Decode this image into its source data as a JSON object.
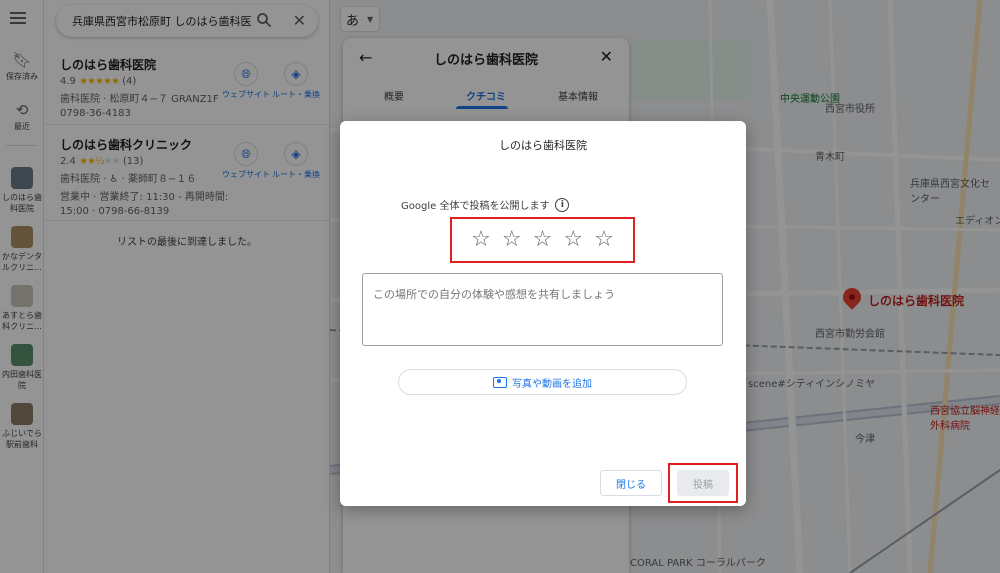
{
  "search": {
    "query": "兵庫県西宮市松原町 しのはら歯科医",
    "ime_char": "あ"
  },
  "rail": {
    "saved": "保存済み",
    "recent": "最近",
    "items": [
      {
        "label": "しのはら歯科医院"
      },
      {
        "label": "かなデンタルクリニ..."
      },
      {
        "label": "あすとら歯科クリニ..."
      },
      {
        "label": "内田歯科医院"
      },
      {
        "label": "ふじいでら駅前歯科"
      }
    ]
  },
  "results": [
    {
      "name": "しのはら歯科医院",
      "rating": "4.9",
      "stars_full": "★★★★★",
      "stars_empty": "",
      "count": "(4)",
      "line2": "歯科医院 · 松原町４−７ GRANZ1F",
      "line3": "0798-36-4183",
      "line4": "",
      "website": "ウェブサイト",
      "route": "ルート・乗換"
    },
    {
      "name": "しのはら歯科クリニック",
      "rating": "2.4",
      "stars_full": "★★½",
      "stars_empty": "★★",
      "count": "(13)",
      "line2": "歯科医院 · ♿ · 薬師町８−１６",
      "line3": "営業中 · 営業終了: 11:30 - 再開時間:",
      "line4": "15:00 · 0798-66-8139",
      "website": "ウェブサイト",
      "route": "ルート・乗換"
    }
  ],
  "end_of_list": "リストの最後に到達しました。",
  "place_panel": {
    "title": "しのはら歯科医院",
    "tabs": [
      "概要",
      "クチコミ",
      "基本情報"
    ]
  },
  "map_labels": {
    "pin": "しのはら歯科医院",
    "l1": "中央運動公園",
    "l2": "西宮市役所",
    "l3": "青木町",
    "l4": "兵庫県西宮文化センター",
    "l5": "エディオン",
    "l6": "西宮市勤労会館",
    "l7": "西宮協立脳神経外科病院",
    "l8": "今津",
    "l9": "CORAL PARK コーラルパーク",
    "l10": "scene#シティインシノミヤ"
  },
  "dialog": {
    "title": "しのはら歯科医院",
    "notice": "Google 全体で投稿を公開します",
    "stars": [
      "☆",
      "☆",
      "☆",
      "☆",
      "☆"
    ],
    "placeholder": "この場所での自分の体験や感想を共有しましょう",
    "add_media": "写真や動画を追加",
    "close": "閉じる",
    "post": "投稿"
  },
  "colors": {
    "accent": "#1a73e8",
    "highlight": "#e0201f",
    "pin": "#ea4335"
  }
}
